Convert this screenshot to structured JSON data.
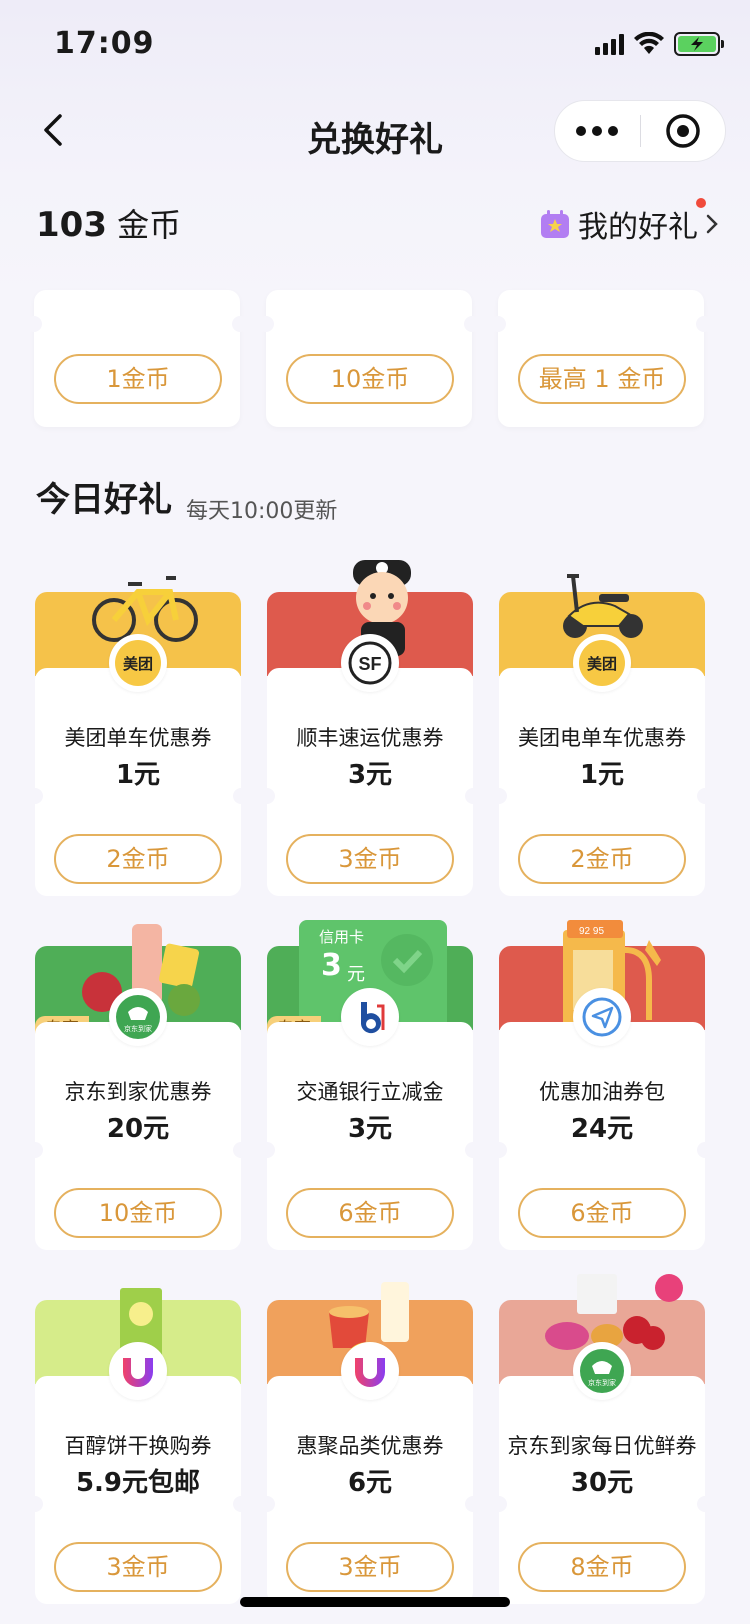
{
  "status_bar": {
    "time": "17:09"
  },
  "navbar": {
    "title": "兑换好礼"
  },
  "coin_bar": {
    "amount": "103",
    "unit": "金币",
    "my_gifts_label": "我的好礼"
  },
  "top_row": [
    {
      "price": "1金币"
    },
    {
      "price": "10金币"
    },
    {
      "price": "最高 1 金币"
    }
  ],
  "section": {
    "title": "今日好礼",
    "subtitle": "每天10:00更新"
  },
  "gifts": [
    {
      "name": "美团单车优惠券",
      "value": "1元",
      "price": "2金币",
      "banner_color": "#f5c24a",
      "logo": "美团"
    },
    {
      "name": "顺丰速运优惠券",
      "value": "3元",
      "price": "3金币",
      "banner_color": "#de5a4d",
      "logo": "SF"
    },
    {
      "name": "美团电单车优惠券",
      "value": "1元",
      "price": "2金币",
      "banner_color": "#f5c24a",
      "logo": "美团"
    },
    {
      "name": "京东到家优惠券",
      "value": "20元",
      "price": "10金币",
      "banner_color": "#4fae57",
      "logo": "京东到家",
      "tag": "专享"
    },
    {
      "name": "交通银行立减金",
      "value": "3元",
      "price": "6金币",
      "banner_color": "#4fae57",
      "logo": "bank",
      "tag": "专享",
      "coupon_label": "信用卡",
      "coupon_amount": "3",
      "coupon_unit": "元"
    },
    {
      "name": "优惠加油券包",
      "value": "24元",
      "price": "6金币",
      "banner_color": "#de5a4d",
      "logo": "fuel"
    },
    {
      "name": "百醇饼干换购券",
      "value": "5.9元包邮",
      "price": "3金币",
      "banner_color": "#d6ec8a",
      "logo": "huiju"
    },
    {
      "name": "惠聚品类优惠券",
      "value": "6元",
      "price": "3金币",
      "banner_color": "#f0a15c",
      "logo": "huiju"
    },
    {
      "name": "京东到家每日优鲜券",
      "value": "30元",
      "price": "8金币",
      "banner_color": "#e9a797",
      "logo": "京东到家"
    }
  ],
  "colors": {
    "accent": "#d9973a",
    "accent_border": "#e5b15e",
    "background": "#f6f5fb"
  }
}
